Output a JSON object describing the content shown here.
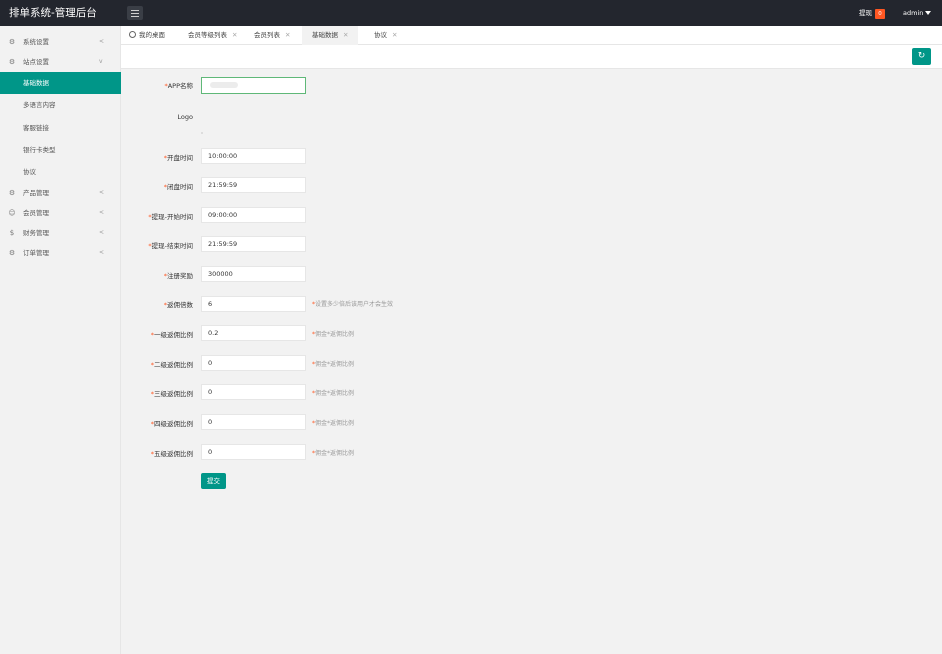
{
  "app_title": "排单系统-管理后台",
  "header": {
    "withdraw_label": "提现",
    "withdraw_badge": "0",
    "user_name": "admin"
  },
  "sidebar": {
    "items": [
      {
        "label": "系统设置",
        "icon": "gear-icon",
        "arrow": "<"
      },
      {
        "label": "站点设置",
        "icon": "gear-icon",
        "arrow": "v"
      },
      {
        "label": "产品管理",
        "icon": "gear-icon",
        "arrow": "<"
      },
      {
        "label": "会员管理",
        "icon": "user-icon",
        "arrow": "<"
      },
      {
        "label": "财务管理",
        "icon": "dollar-icon",
        "arrow": "<"
      },
      {
        "label": "订单管理",
        "icon": "gear-icon",
        "arrow": "<"
      }
    ],
    "sub_items": [
      {
        "label": "基础数据",
        "active": true
      },
      {
        "label": "多语言内容"
      },
      {
        "label": "客服链接"
      },
      {
        "label": "银行卡类型"
      },
      {
        "label": "协议"
      }
    ]
  },
  "tabs": [
    {
      "label": "我的桌面"
    },
    {
      "label": "会员等级列表",
      "close": "✕"
    },
    {
      "label": "会员列表",
      "close": "✕"
    },
    {
      "label": "基础数据",
      "close": "✕",
      "active": true
    },
    {
      "label": "协议",
      "close": "✕"
    }
  ],
  "refresh_icon": "refresh-icon",
  "form": {
    "required_mark": "*",
    "fields": [
      {
        "label": "APP名称",
        "required": true,
        "value": ""
      },
      {
        "label": "Logo",
        "required": false
      },
      {
        "label": "开盘时间",
        "required": true,
        "value": "10:00:00"
      },
      {
        "label": "闭盘时间",
        "required": true,
        "value": "21:59:59"
      },
      {
        "label": "提现-开始时间",
        "required": true,
        "value": "09:00:00"
      },
      {
        "label": "提现-结束时间",
        "required": true,
        "value": "21:59:59"
      },
      {
        "label": "注册奖励",
        "required": true,
        "value": "300000"
      },
      {
        "label": "返佣倍数",
        "required": true,
        "value": "6",
        "hint": "设置多少倍后该用户才会生效"
      },
      {
        "label": "一级返佣比例",
        "required": true,
        "value": "0.2",
        "hint": "佣金*返佣比例"
      },
      {
        "label": "二级返佣比例",
        "required": true,
        "value": "0",
        "hint": "佣金*返佣比例"
      },
      {
        "label": "三级返佣比例",
        "required": true,
        "value": "0",
        "hint": "佣金*返佣比例"
      },
      {
        "label": "四级返佣比例",
        "required": true,
        "value": "0",
        "hint": "佣金*返佣比例"
      },
      {
        "label": "五级返佣比例",
        "required": true,
        "value": "0",
        "hint": "佣金*返佣比例"
      }
    ],
    "submit_label": "提交"
  },
  "colors": {
    "accent": "#009688",
    "topbar": "#23262e",
    "badge": "#ff5722",
    "required": "#ff5722"
  }
}
